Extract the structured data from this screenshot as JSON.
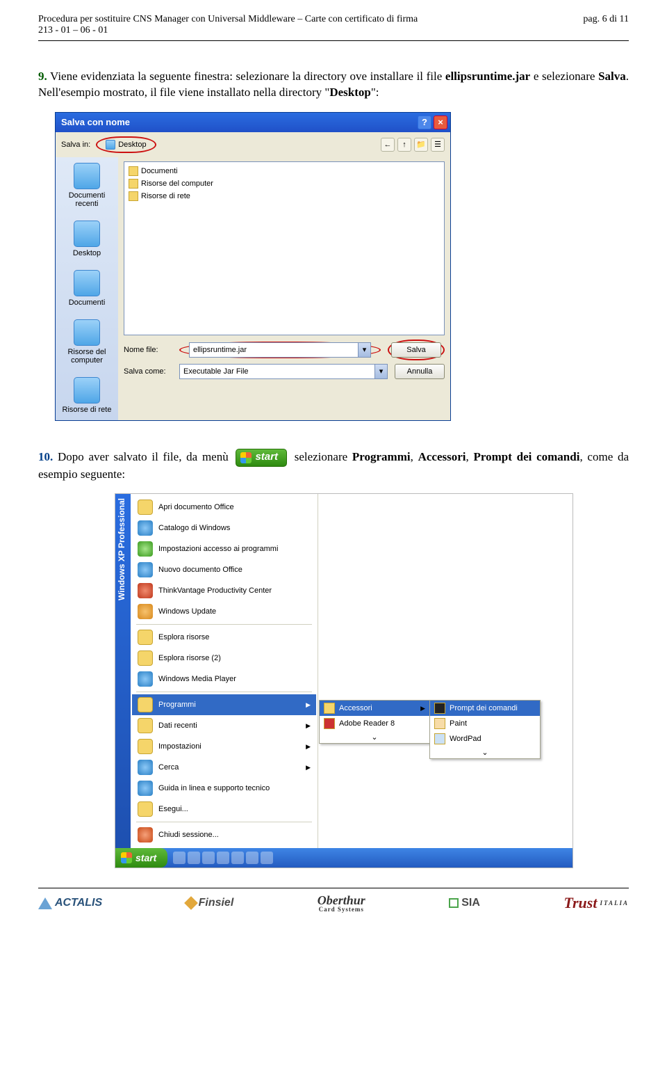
{
  "header": {
    "title_line1": "Procedura per sostituire CNS Manager con Universal Middleware – Carte con certificato di firma",
    "title_line2": "213 - 01 – 06 - 01",
    "page_label": "pag. 6 di 11"
  },
  "step9": {
    "number": "9.",
    "text_before_first_bold": " Viene evidenziata la seguente finestra: selezionare la directory ove installare il file ",
    "bold1": "ellipsruntime.jar",
    "text_between": " e selezionare ",
    "bold2": "Salva",
    "text_after": ". Nell'esempio mostrato, il file viene installato nella directory \"",
    "bold3": "Desktop",
    "text_end": "\":"
  },
  "save_dialog": {
    "title": "Salva con nome",
    "help": "?",
    "close": "×",
    "save_in_label": "Salva in:",
    "save_in_value": "Desktop",
    "nav_icons": [
      "←",
      "↑",
      "📁",
      "☰"
    ],
    "places": [
      "Documenti recenti",
      "Desktop",
      "Documenti",
      "Risorse del computer",
      "Risorse di rete"
    ],
    "file_items": [
      "Documenti",
      "Risorse del computer",
      "Risorse di rete"
    ],
    "filename_label": "Nome file:",
    "filename_value": "ellipsruntime.jar",
    "saveas_label": "Salva come:",
    "saveas_value": "Executable Jar File",
    "btn_save": "Salva",
    "btn_cancel": "Annulla"
  },
  "step10": {
    "number": "10.",
    "text_before": " Dopo aver salvato il file, da menù ",
    "start_label": "start",
    "text_mid": " selezionare ",
    "b1": "Programmi",
    "sep": ", ",
    "b2": "Accessori",
    "b3": "Prompt dei comandi",
    "text_end": ", come da esempio seguente:"
  },
  "startmenu": {
    "sidebar_text": "Windows XP Professional",
    "left_items": [
      {
        "label": "Apri documento Office",
        "ic": "folder"
      },
      {
        "label": "Catalogo di Windows",
        "ic": "blue"
      },
      {
        "label": "Impostazioni accesso ai programmi",
        "ic": "green"
      },
      {
        "label": "Nuovo documento Office",
        "ic": "blue"
      },
      {
        "label": "ThinkVantage Productivity Center",
        "ic": "red"
      },
      {
        "label": "Windows Update",
        "ic": "orange"
      },
      {
        "label": "SEP",
        "ic": ""
      },
      {
        "label": "Esplora risorse",
        "ic": "folder"
      },
      {
        "label": "Esplora risorse (2)",
        "ic": "folder"
      },
      {
        "label": "Windows Media Player",
        "ic": "blue"
      },
      {
        "label": "SEP",
        "ic": ""
      },
      {
        "label": "Programmi",
        "ic": "folder",
        "arrow": true,
        "sel": true
      },
      {
        "label": "Dati recenti",
        "ic": "folder",
        "arrow": true
      },
      {
        "label": "Impostazioni",
        "ic": "folder",
        "arrow": true
      },
      {
        "label": "Cerca",
        "ic": "blue",
        "arrow": true
      },
      {
        "label": "Guida in linea e supporto tecnico",
        "ic": "blue"
      },
      {
        "label": "Esegui...",
        "ic": "folder"
      },
      {
        "label": "SEP",
        "ic": ""
      },
      {
        "label": "Chiudi sessione...",
        "ic": "off"
      }
    ],
    "sub1": [
      {
        "label": "Accessori",
        "ic": "folder",
        "arrow": true,
        "sel": true
      },
      {
        "label": "Adobe Reader 8",
        "ic": "adobe"
      },
      {
        "label": "CHEVRON",
        "ic": ""
      }
    ],
    "sub2": [
      {
        "label": "Prompt dei comandi",
        "ic": "cmd",
        "sel": true
      },
      {
        "label": "Paint",
        "ic": "paint"
      },
      {
        "label": "WordPad",
        "ic": "wp"
      },
      {
        "label": "CHEVRON",
        "ic": ""
      }
    ],
    "taskbar_start": "start"
  },
  "footer": {
    "actalis": "ACTALIS",
    "finsiel": "Finsiel",
    "oberthur": "Oberthur",
    "oberthur_sub": "Card Systems",
    "sia": "SIA",
    "trust": "Trust",
    "trust_sub": "ITALIA"
  }
}
